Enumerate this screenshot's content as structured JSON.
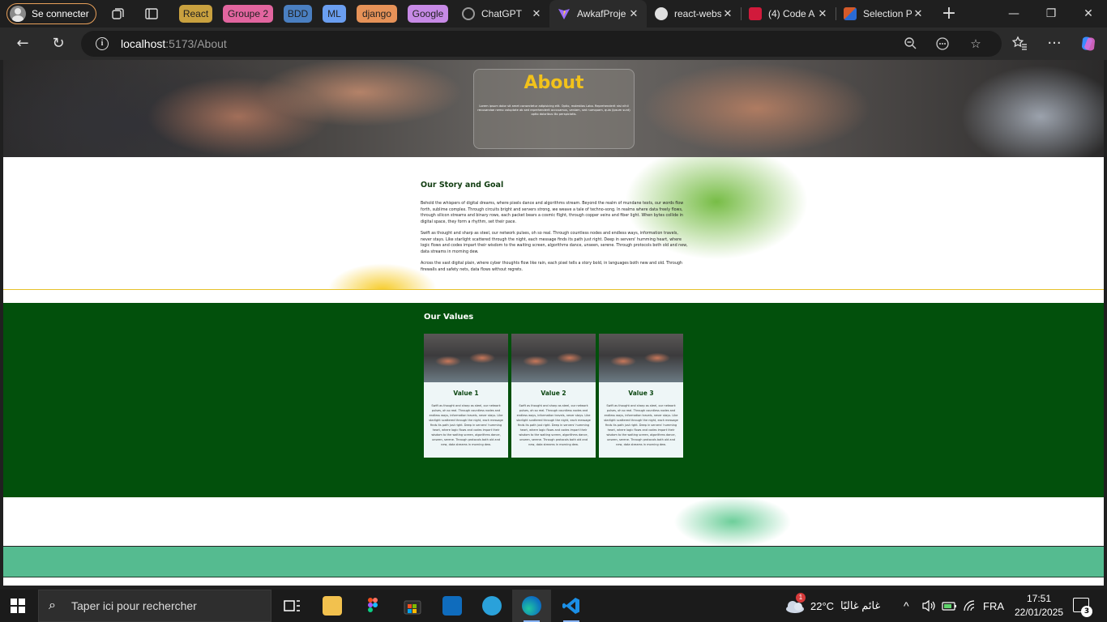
{
  "browser": {
    "profile_label": "Se connecter",
    "tab_groups": [
      {
        "label": "React",
        "bg": "#c9a13f",
        "fg": "#1f1f1f"
      },
      {
        "label": "Groupe 2",
        "bg": "#e2659f",
        "fg": "#1f1f1f"
      },
      {
        "label": "BDD",
        "bg": "#4a7fc1",
        "fg": "#1f1f1f"
      },
      {
        "label": "ML",
        "bg": "#6a9ef0",
        "fg": "#1f1f1f"
      },
      {
        "label": "django",
        "bg": "#e69258",
        "fg": "#1f1f1f"
      },
      {
        "label": "Google",
        "bg": "#c78ae6",
        "fg": "#1f1f1f"
      }
    ],
    "tabs": [
      {
        "title": "ChatGPT",
        "favicon_color": "#9a9a9a"
      },
      {
        "title": "AwkafProje",
        "favicon_color": "#a66bff"
      },
      {
        "title": "react-webs",
        "favicon_color": "#e0e0e0"
      },
      {
        "title": "(4) Code A",
        "favicon_color": "#d11a3b"
      },
      {
        "title": "Selection P",
        "favicon_color": "#d45a2a"
      }
    ],
    "address": {
      "host": "localhost",
      "path": ":5173/About"
    }
  },
  "page": {
    "hero": {
      "title": "About",
      "text": "Lorem ipsum dolor sit amet consectetur adipisicing elit. Optio, molestias Labo. Reprehenderit nisi nihil recusandae nemo voluptate ab sed reprehenderit accusamus, veniam, sed numquam, quia (ipsum sunt) optio doloribus illo perspiciatis."
    },
    "story": {
      "heading": "Our Story and Goal",
      "paragraphs": [
        "Behold the whispers of digital dreams, where pixels dance and algorithms stream. Beyond the realm of mundane texts, our words flow forth, sublime complex. Through circuits bright and servers strong, we weave a tale of techno-song. In realms where data freely flows, through silicon streams and binary rows, each packet bears a cosmic flight, through copper veins and fiber light. When bytes collide in digital space, they form a rhythm, set their pace.",
        "Swift as thought and sharp as steel, our network pulses, oh so real. Through countless nodes and endless ways, information travels, never stays. Like starlight scattered through the night, each message finds its path just right. Deep in servers' humming heart, where logic flows and codes impart their wisdom to the waiting screen, algorithms dance, unseen, serene. Through protocols both old and new, data streams in morning dew.",
        "Across the vast digital plain, where cyber thoughts flow like rain, each pixel tells a story bold, in languages both new and old. Through firewalls and safety nets, data flows without regrets."
      ]
    },
    "values": {
      "heading": "Our Values",
      "cards": [
        {
          "title": "Value 1",
          "text": "Swift as thought and sharp as steel, our network pulses, oh so real. Through countless nodes and endless ways, information travels, never stays. Like starlight scattered through the night, each message finds its path just right. Deep in servers' humming heart, where logic flows and codes impart their wisdom to the waiting screen, algorithms dance, unseen, serene. Through protocols both old and new, data streams in morning dew."
        },
        {
          "title": "Value 2",
          "text": "Swift as thought and sharp as steel, our network pulses, oh so real. Through countless nodes and endless ways, information travels, never stays. Like starlight scattered through the night, each message finds its path just right. Deep in servers' humming heart, where logic flows and codes impart their wisdom to the waiting screen, algorithms dance, unseen, serene. Through protocols both old and new, data streams in morning dew."
        },
        {
          "title": "Value 3",
          "text": "Swift as thought and sharp as steel, our network pulses, oh so real. Through countless nodes and endless ways, information travels, never stays. Like starlight scattered through the night, each message finds its path just right. Deep in servers' humming heart, where logic flows and codes impart their wisdom to the waiting screen, algorithms dance, unseen, serene. Through protocols both old and new, data streams in morning dew."
        }
      ]
    }
  },
  "taskbar": {
    "search_placeholder": "Taper ici pour rechercher",
    "weather_temp": "22°C",
    "weather_desc": "غائم غالبًا",
    "weather_badge": "1",
    "language": "FRA",
    "time": "17:51",
    "date": "22/01/2025",
    "notification_count": "3"
  }
}
